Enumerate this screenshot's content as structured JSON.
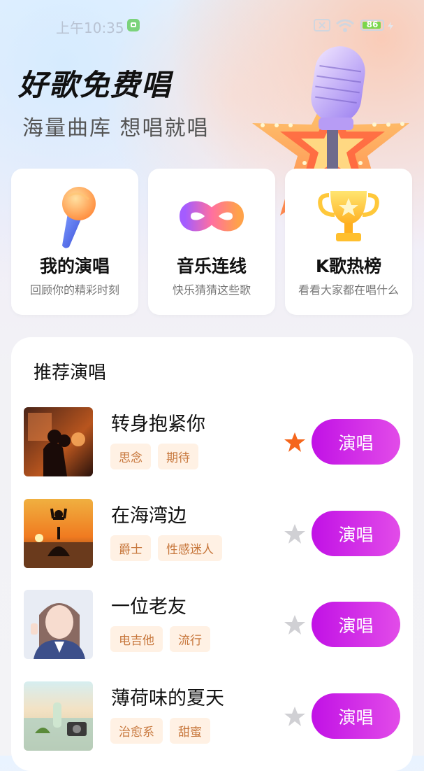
{
  "status_bar": {
    "time": "上午10:35",
    "battery": "86"
  },
  "hero": {
    "title": "好歌免费唱",
    "subtitle": "海量曲库 想唱就唱"
  },
  "features": [
    {
      "title": "我的演唱",
      "desc": "回顾你的精彩时刻",
      "icon": "microphone-icon"
    },
    {
      "title": "音乐连线",
      "desc": "快乐猜猜这些歌",
      "icon": "infinity-icon"
    },
    {
      "title": "K歌热榜",
      "desc": "看看大家都在唱什么",
      "icon": "trophy-icon"
    }
  ],
  "recommend": {
    "title": "推荐演唱",
    "button_label": "演唱",
    "songs": [
      {
        "name": "转身抱紧你",
        "tags": [
          "思念",
          "期待"
        ],
        "favorited": true
      },
      {
        "name": "在海湾边",
        "tags": [
          "爵士",
          "性感迷人"
        ],
        "favorited": false
      },
      {
        "name": "一位老友",
        "tags": [
          "电吉他",
          "流行"
        ],
        "favorited": false
      },
      {
        "name": "薄荷味的夏天",
        "tags": [
          "治愈系",
          "甜蜜"
        ],
        "favorited": false
      }
    ]
  },
  "colors": {
    "accent": "#c111e6",
    "star_active": "#f5661c",
    "star_inactive": "#d0d0d4",
    "tag_text": "#c7773c",
    "tag_bg": "#fff1e4"
  }
}
